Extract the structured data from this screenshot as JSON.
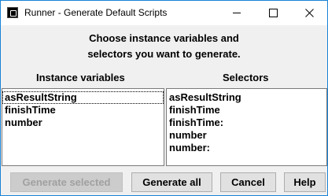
{
  "window": {
    "title": "Runner - Generate Default Scripts"
  },
  "prompt": {
    "line1": "Choose instance variables and",
    "line2": "selectors you want to generate."
  },
  "instance_variables": {
    "header": "Instance variables",
    "items": [
      "asResultString",
      "finishTime",
      "number"
    ],
    "focused_index": 0
  },
  "selectors": {
    "header": "Selectors",
    "items": [
      "asResultString",
      "finishTime",
      "finishTime:",
      "number",
      "number:"
    ]
  },
  "buttons": {
    "generate_selected": "Generate selected",
    "generate_all": "Generate all",
    "cancel": "Cancel",
    "help": "Help"
  },
  "colors": {
    "window_border": "#1883d7",
    "dialog_bg": "#f0f0f0",
    "button_bg": "#e1e1e1",
    "disabled_text": "#a0a0a0"
  }
}
